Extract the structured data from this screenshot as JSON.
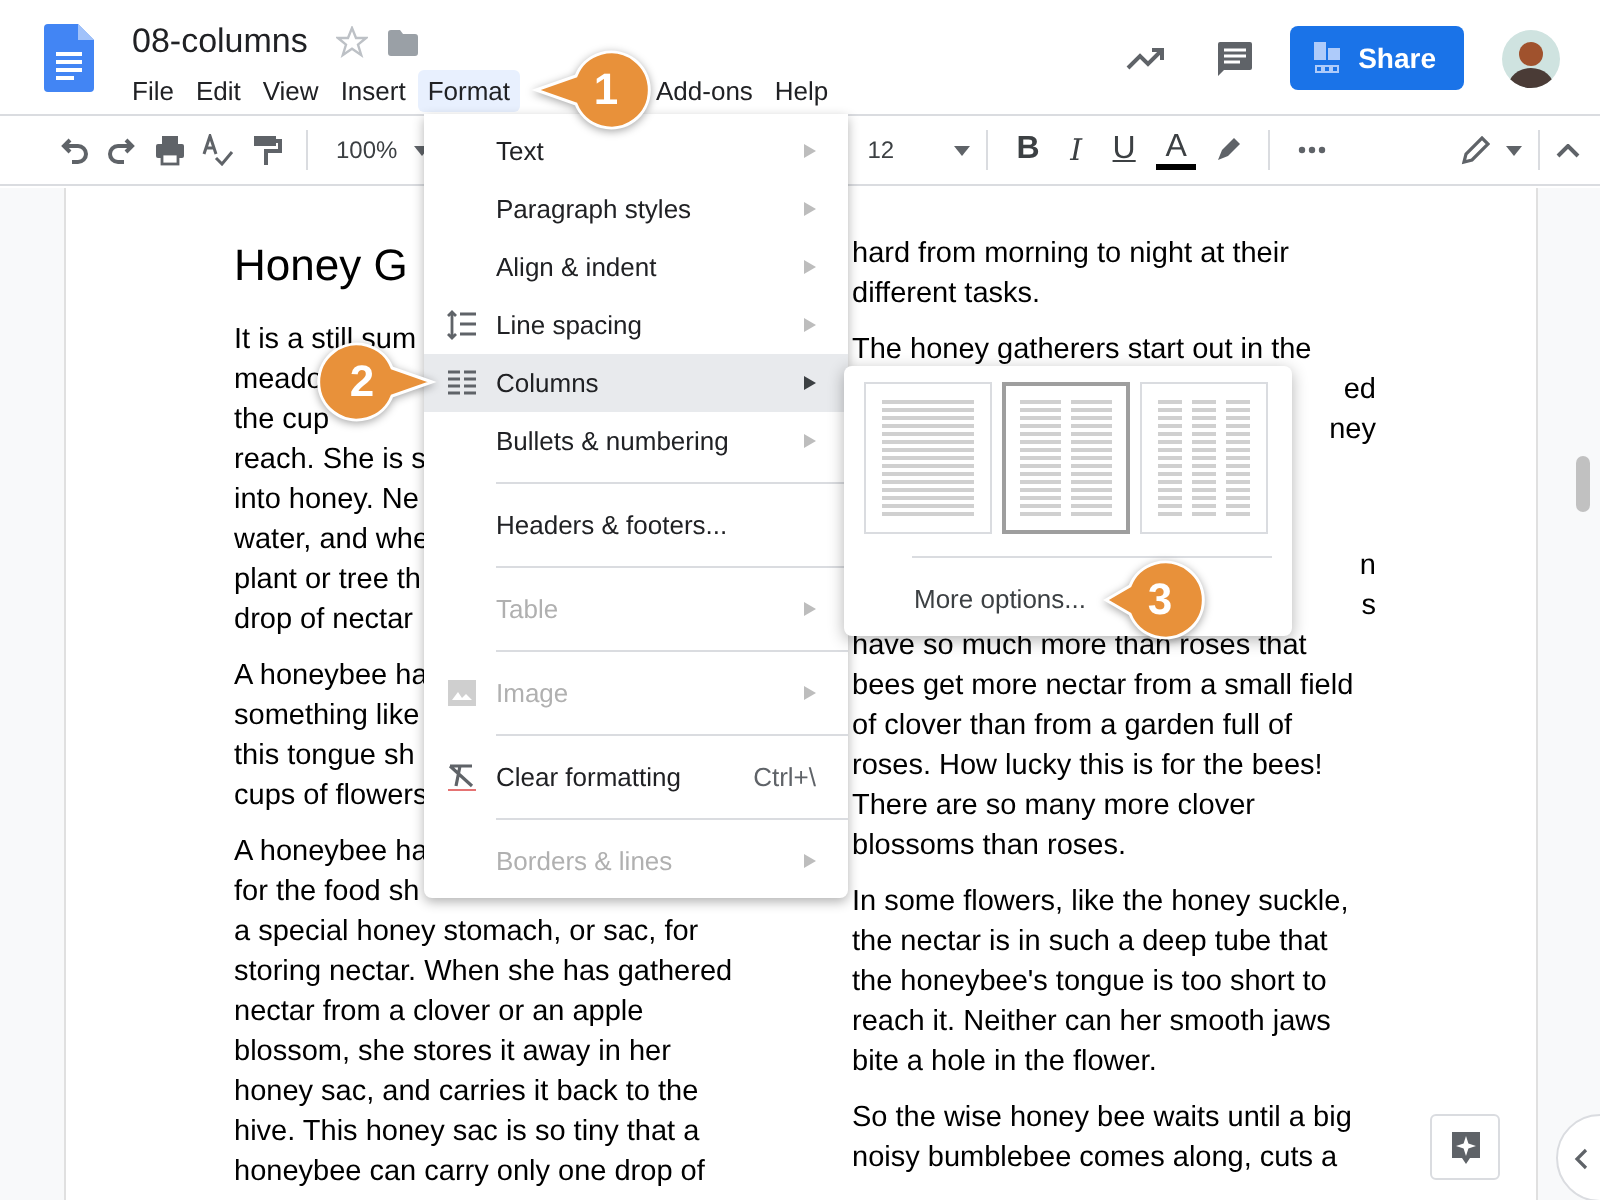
{
  "header": {
    "doc_title": "08-columns",
    "share_button": "Share"
  },
  "menu_bar": [
    {
      "label": "File",
      "selected": false
    },
    {
      "label": "Edit",
      "selected": false
    },
    {
      "label": "View",
      "selected": false
    },
    {
      "label": "Insert",
      "selected": false
    },
    {
      "label": "Format",
      "selected": true
    },
    {
      "label": "Add-ons",
      "selected": false
    },
    {
      "label": "Help",
      "selected": false
    }
  ],
  "toolbar": {
    "zoom": "100%",
    "font_size": "12",
    "bold": "B",
    "italic": "I",
    "underline": "U",
    "text_color": "A"
  },
  "document": {
    "left_column": {
      "title": "Honey G",
      "paragraphs": [
        [
          "It is a still sum",
          "meado",
          "the cup",
          "reach. She is s",
          "into honey. Ne",
          "water, and whe",
          "plant or tree th",
          "drop of nectar"
        ],
        [
          "A honeybee ha",
          "something like",
          "this tongue sh",
          "cups of flowers"
        ],
        [
          "A honeybee ha",
          "for the food sh",
          "a special honey stomach, or sac, for",
          "storing nectar. When she has gathered",
          "nectar from a clover or an apple",
          "blossom, she stores it away in her",
          "honey sac, and carries it back to the",
          "hive. This honey sac is so tiny that a",
          "honeybee can carry only one drop of"
        ]
      ]
    },
    "right_column": {
      "paragraphs": [
        [
          {
            "text": "hard from morning to night at their",
            "kind": "line"
          },
          {
            "text": "different tasks.",
            "kind": "line"
          }
        ],
        [
          {
            "text": "The honey gatherers start out in the",
            "kind": "line"
          },
          {
            "text": "ed",
            "kind": "tail"
          },
          {
            "text": "ney",
            "kind": "tail"
          }
        ],
        [
          {
            "text": "n",
            "kind": "tail"
          },
          {
            "text": "s",
            "kind": "tail"
          },
          {
            "text": "have so much more than roses that",
            "kind": "line"
          },
          {
            "text": "bees get more nectar from a small field",
            "kind": "line"
          },
          {
            "text": "of clover than from a garden full of",
            "kind": "line"
          },
          {
            "text": "roses. How lucky this is for the bees!",
            "kind": "line"
          },
          {
            "text": "There are so many more clover",
            "kind": "line"
          },
          {
            "text": "blossoms than roses.",
            "kind": "line"
          }
        ],
        [
          {
            "text": "In some flowers, like the honey suckle,",
            "kind": "line"
          },
          {
            "text": "the nectar is in such a deep tube that",
            "kind": "line"
          },
          {
            "text": "the honeybee's tongue is too short to",
            "kind": "line"
          },
          {
            "text": "reach it. Neither can her smooth jaws",
            "kind": "line"
          },
          {
            "text": "bite a hole in the flower.",
            "kind": "line"
          }
        ],
        [
          {
            "text": "So the wise honey bee waits until a big",
            "kind": "line"
          },
          {
            "text": "noisy bumblebee comes along, cuts a",
            "kind": "line"
          }
        ]
      ]
    }
  },
  "format_menu": [
    {
      "kind": "submenu",
      "label": "Text",
      "disabled": false,
      "selected": false
    },
    {
      "kind": "submenu",
      "label": "Paragraph styles",
      "disabled": false,
      "selected": false
    },
    {
      "kind": "submenu",
      "label": "Align & indent",
      "disabled": false,
      "selected": false
    },
    {
      "kind": "submenu",
      "label": "Line spacing",
      "disabled": false,
      "selected": false
    },
    {
      "kind": "submenu",
      "label": "Columns",
      "disabled": false,
      "selected": true
    },
    {
      "kind": "submenu",
      "label": "Bullets & numbering",
      "disabled": false,
      "selected": false
    },
    {
      "kind": "divider"
    },
    {
      "kind": "action",
      "label": "Headers & footers...",
      "disabled": false,
      "selected": false
    },
    {
      "kind": "divider"
    },
    {
      "kind": "submenu",
      "label": "Table",
      "disabled": true,
      "selected": false
    },
    {
      "kind": "divider"
    },
    {
      "kind": "submenu",
      "label": "Image",
      "disabled": true,
      "selected": false
    },
    {
      "kind": "divider"
    },
    {
      "kind": "action",
      "label": "Clear formatting",
      "shortcut": "Ctrl+\\",
      "disabled": false,
      "selected": false
    },
    {
      "kind": "divider"
    },
    {
      "kind": "submenu",
      "label": "Borders & lines",
      "disabled": true,
      "selected": false
    }
  ],
  "columns_submenu": {
    "presets": [
      {
        "selected": false
      },
      {
        "selected": true
      },
      {
        "selected": false
      }
    ],
    "more_options": "More options..."
  },
  "callouts": [
    {
      "number": "1"
    },
    {
      "number": "2"
    },
    {
      "number": "3"
    }
  ]
}
